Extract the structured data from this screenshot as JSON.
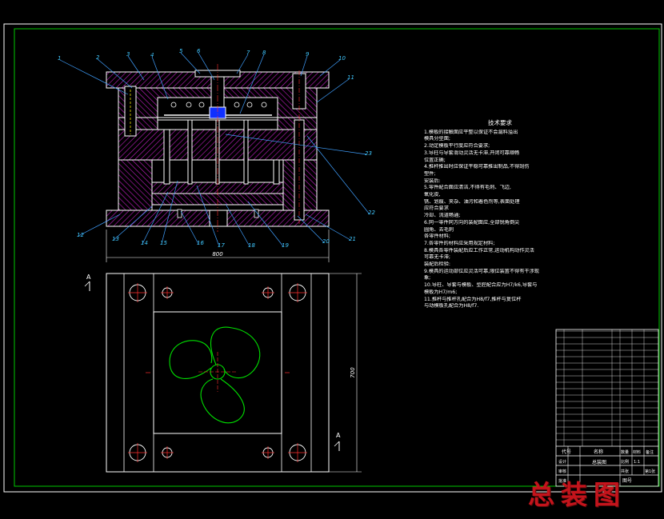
{
  "colors": {
    "background": "#000000",
    "frame": "#00c800",
    "outline": "#ffffff",
    "hatch": "#c020c0",
    "leader": "#40a0ff",
    "label": "#40c8ff",
    "centerline": "#ff3030",
    "part_green": "#00e000",
    "core_blue": "#1030ff",
    "yellow": "#f0e000",
    "watermark": "#c4141c"
  },
  "part_numbers": [
    "1",
    "2",
    "3",
    "4",
    "5",
    "6",
    "7",
    "8",
    "9",
    "10",
    "11",
    "12",
    "13",
    "14",
    "15",
    "16",
    "17",
    "18",
    "19",
    "20",
    "21",
    "22",
    "23"
  ],
  "dimensions": {
    "width": "800",
    "height": "700"
  },
  "section_marks": {
    "left": "A",
    "right": "A"
  },
  "requirements": {
    "title": "技术要求",
    "lines": [
      "1.模板的接触面应平整以保证不会漏料溢出",
      "  模具分型面;",
      "2.动定模板平行度应符合要求;",
      "3.导柱与导套滑动灵活无卡滞,开闭可靠顺畅",
      "  位置正确;",
      "4.推杆推出时应保证平稳可靠推出制品,不得刮伤",
      "  塑件;",
      "    安装后:",
      "5.零件配合面应清洁,不得有毛刺、飞边,",
      "  氧化皮,",
      "  锈、划痕、夹杂、油污和着色剂等,表面处理",
      "  应符合要求",
      "    冷却、流道畅通;",
      "6.同一零件同方向的装配面应,全部锐角倒尖",
      "  圆角、去毛刺",
      "    各零件材料;",
      "7.各零件的材料应采用规定材料;",
      "8.模具各零件装配后应工作正常,运动机构动作灵活",
      "  可靠无卡滞;",
      "    装配后检验:",
      "9.模具的运动部位应灵活可靠,限位装置不得有干涉现",
      "  象;",
      "10.导柱、导套与模板、型腔配合应为H7/k6,导套与",
      "  模板为H7/m6;",
      "11.推杆与推杆孔配合为H8/f7,推杆与复位杆",
      "  与动模板孔配合为H8/f7."
    ]
  },
  "title_block": {
    "header_code": "代号",
    "header_name": "名称",
    "header_qty": "数量",
    "header_material": "材料",
    "header_note": "备注",
    "drawing_name": "总装图",
    "scale": "比例",
    "scale_value": "1:1",
    "sheet": "共张",
    "sheet_value": "第1张",
    "designer": "设计",
    "checker": "审核",
    "approver": "批准",
    "drawing_no": "图号"
  },
  "watermark": "总装图"
}
